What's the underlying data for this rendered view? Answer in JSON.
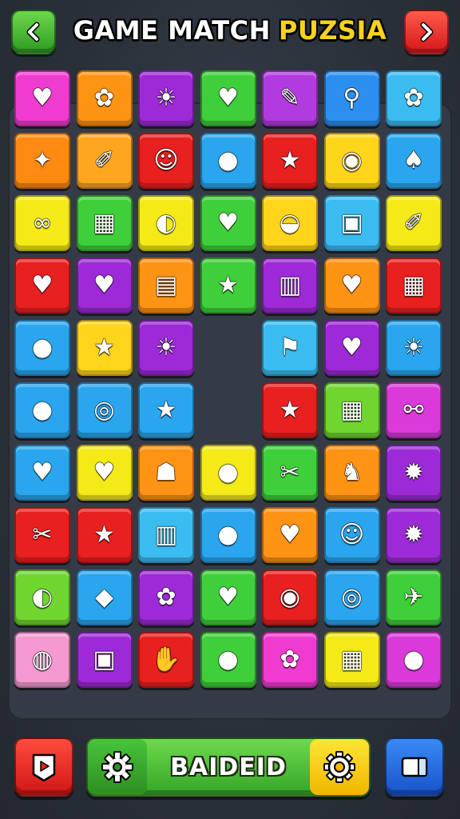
{
  "header": {
    "title_part1": "GAME MATCH",
    "title_part2": "PUZSIA",
    "back_icon": "chevron-left-icon",
    "next_icon": "chevron-right-icon"
  },
  "board": {
    "columns": 7,
    "rows": [
      [
        {
          "color": "#f03bd0",
          "icon": "♥",
          "name": "heart"
        },
        {
          "color": "#ff9314",
          "icon": "✿",
          "name": "flower"
        },
        {
          "color": "#9d2ad6",
          "icon": "☀",
          "name": "sun"
        },
        {
          "color": "#3fcf3a",
          "icon": "♥",
          "name": "heart"
        },
        {
          "color": "#b23be0",
          "icon": "✎",
          "name": "pencil"
        },
        {
          "color": "#2b8ff0",
          "icon": "⚲",
          "name": "magnifier"
        },
        {
          "color": "#3bbcf0",
          "icon": "✿",
          "name": "flower"
        }
      ],
      [
        {
          "color": "#ff8a12",
          "icon": "✦",
          "name": "splat"
        },
        {
          "color": "#ffa520",
          "icon": "✐",
          "name": "pencil"
        },
        {
          "color": "#e8201f",
          "icon": "☺",
          "name": "face"
        },
        {
          "color": "#2aa6ef",
          "icon": "●",
          "name": "apple"
        },
        {
          "color": "#e8201f",
          "icon": "★",
          "name": "star"
        },
        {
          "color": "#ffd51c",
          "icon": "◉",
          "name": "orange"
        },
        {
          "color": "#2aa6ef",
          "icon": "♠",
          "name": "leaf"
        }
      ],
      [
        {
          "color": "#f3ea18",
          "icon": "∞",
          "name": "rings"
        },
        {
          "color": "#3fcf3a",
          "icon": "▦",
          "name": "calculator"
        },
        {
          "color": "#f3ea18",
          "icon": "◐",
          "name": "leaf"
        },
        {
          "color": "#3fcf3a",
          "icon": "♥",
          "name": "heart"
        },
        {
          "color": "#ffd51c",
          "icon": "◒",
          "name": "soap"
        },
        {
          "color": "#3bbcf0",
          "icon": "▣",
          "name": "box"
        },
        {
          "color": "#f3ea18",
          "icon": "✐",
          "name": "pencil"
        }
      ],
      [
        {
          "color": "#e8201f",
          "icon": "♥",
          "name": "heart"
        },
        {
          "color": "#9d2ad6",
          "icon": "♥",
          "name": "heart"
        },
        {
          "color": "#ff9314",
          "icon": "▤",
          "name": "card"
        },
        {
          "color": "#3fcf3a",
          "icon": "★",
          "name": "star"
        },
        {
          "color": "#9d2ad6",
          "icon": "▥",
          "name": "cup"
        },
        {
          "color": "#ff9314",
          "icon": "♥",
          "name": "heart"
        },
        {
          "color": "#e8201f",
          "icon": "▦",
          "name": "basket"
        }
      ],
      [
        {
          "color": "#2aa6ef",
          "icon": "●",
          "name": "apple"
        },
        {
          "color": "#ffd51c",
          "icon": "★",
          "name": "star"
        },
        {
          "color": "#9d2ad6",
          "icon": "☀",
          "name": "sun"
        },
        {
          "color": "",
          "icon": "",
          "name": "empty"
        },
        {
          "color": "#3bbcf0",
          "icon": "⚑",
          "name": "flag"
        },
        {
          "color": "#9d2ad6",
          "icon": "♥",
          "name": "heart"
        },
        {
          "color": "#2aa6ef",
          "icon": "☀",
          "name": "sun"
        }
      ],
      [
        {
          "color": "#2aa6ef",
          "icon": "●",
          "name": "apple"
        },
        {
          "color": "#2aa6ef",
          "icon": "◎",
          "name": "ring"
        },
        {
          "color": "#2aa6ef",
          "icon": "★",
          "name": "star"
        },
        {
          "color": "",
          "icon": "",
          "name": "empty"
        },
        {
          "color": "#e8201f",
          "icon": "★",
          "name": "star"
        },
        {
          "color": "#6fd630",
          "icon": "▦",
          "name": "basket"
        },
        {
          "color": "#d93ad9",
          "icon": "⚯",
          "name": "keys"
        }
      ],
      [
        {
          "color": "#2aa6ef",
          "icon": "♥",
          "name": "heart"
        },
        {
          "color": "#f3ea18",
          "icon": "♥",
          "name": "lollipop"
        },
        {
          "color": "#ff9314",
          "icon": "☗",
          "name": "bell"
        },
        {
          "color": "#f3ea18",
          "icon": "●",
          "name": "apple"
        },
        {
          "color": "#3fcf3a",
          "icon": "✂",
          "name": "tool"
        },
        {
          "color": "#ff9314",
          "icon": "♞",
          "name": "figure"
        },
        {
          "color": "#9d2ad6",
          "icon": "✹",
          "name": "gear"
        }
      ],
      [
        {
          "color": "#e8201f",
          "icon": "✂",
          "name": "scissors"
        },
        {
          "color": "#e8201f",
          "icon": "★",
          "name": "star"
        },
        {
          "color": "#3bbcf0",
          "icon": "▥",
          "name": "fries"
        },
        {
          "color": "#2aa6ef",
          "icon": "●",
          "name": "apple"
        },
        {
          "color": "#ff9314",
          "icon": "♥",
          "name": "heart"
        },
        {
          "color": "#2aa6ef",
          "icon": "☺",
          "name": "face"
        },
        {
          "color": "#9d2ad6",
          "icon": "✹",
          "name": "gear"
        }
      ],
      [
        {
          "color": "#6fd630",
          "icon": "◐",
          "name": "leaf"
        },
        {
          "color": "#2aa6ef",
          "icon": "◆",
          "name": "card"
        },
        {
          "color": "#9d2ad6",
          "icon": "✿",
          "name": "flower"
        },
        {
          "color": "#3fcf3a",
          "icon": "♥",
          "name": "heart"
        },
        {
          "color": "#e8201f",
          "icon": "◉",
          "name": "stopwatch"
        },
        {
          "color": "#2aa6ef",
          "icon": "◎",
          "name": "dial"
        },
        {
          "color": "#3fcf3a",
          "icon": "✈",
          "name": "bird"
        }
      ],
      [
        {
          "color": "#f59ad0",
          "icon": "◍",
          "name": "pin"
        },
        {
          "color": "#9d2ad6",
          "icon": "▣",
          "name": "device"
        },
        {
          "color": "#e8201f",
          "icon": "✋",
          "name": "hand"
        },
        {
          "color": "#3fcf3a",
          "icon": "●",
          "name": "balloon"
        },
        {
          "color": "#f03bd0",
          "icon": "✿",
          "name": "flower"
        },
        {
          "color": "#f3ea18",
          "icon": "▦",
          "name": "radio"
        },
        {
          "color": "#d93ad9",
          "icon": "●",
          "name": "apple"
        }
      ]
    ]
  },
  "footer": {
    "left_icon": "play-card-icon",
    "gear_icon": "gear-icon",
    "center_label": "BAIDEID",
    "right_icon": "window-icon"
  }
}
